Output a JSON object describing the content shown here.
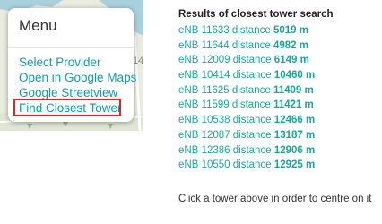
{
  "map": {
    "visible_label": "14"
  },
  "menu": {
    "title": "Menu",
    "items": [
      {
        "label": "Select Provider"
      },
      {
        "label": "Open in Google Maps"
      },
      {
        "label": "Google Streetview"
      },
      {
        "label": "Find Closest Tower"
      }
    ],
    "highlighted_item": "Find Closest Tower",
    "colors": {
      "link": "#0c9fa6",
      "highlight": "#e0252b"
    }
  },
  "results": {
    "title": "Results of closest tower search",
    "items": [
      {
        "tower": "eNB 11633",
        "word": "distance",
        "distance": "5019 m"
      },
      {
        "tower": "eNB 11644",
        "word": "distance",
        "distance": "4982 m"
      },
      {
        "tower": "eNB 12009",
        "word": "distance",
        "distance": "6149 m"
      },
      {
        "tower": "eNB 10414",
        "word": "distance",
        "distance": "10460 m"
      },
      {
        "tower": "eNB 11625",
        "word": "distance",
        "distance": "11409 m"
      },
      {
        "tower": "eNB 11599",
        "word": "distance",
        "distance": "11421 m"
      },
      {
        "tower": "eNB 10538",
        "word": "distance",
        "distance": "12466 m"
      },
      {
        "tower": "eNB 12087",
        "word": "distance",
        "distance": "13187 m"
      },
      {
        "tower": "eNB 12386",
        "word": "distance",
        "distance": "12906 m"
      },
      {
        "tower": "eNB 10550",
        "word": "distance",
        "distance": "12925 m"
      }
    ],
    "hint": "Click a tower above in order to centre on it",
    "colors": {
      "link": "#1aa79a"
    }
  }
}
